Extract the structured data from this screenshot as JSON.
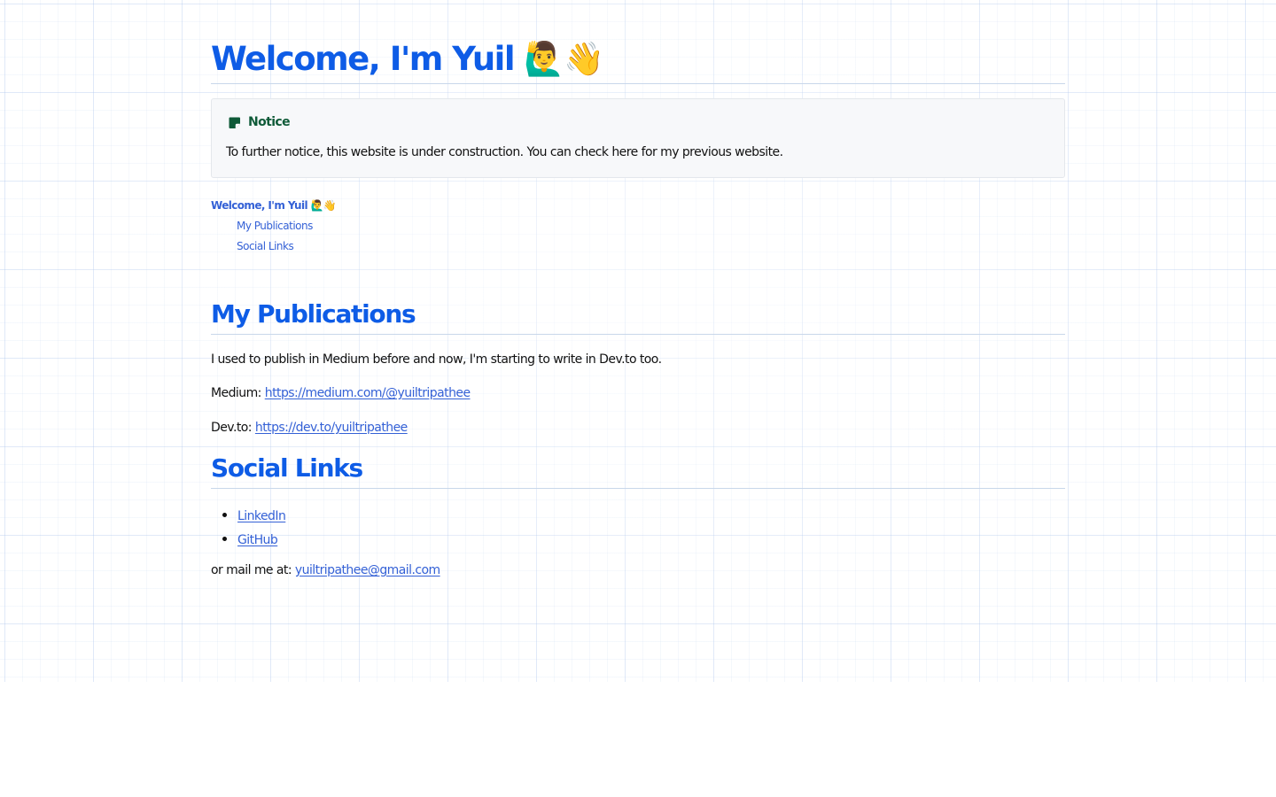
{
  "header": {
    "title": "Welcome, I'm Yuil 🙋‍♂️👋"
  },
  "notice": {
    "title": "Notice",
    "text": "To further notice, this website is under construction. You can check here for my previous website.",
    "accent_color": "#0f5a38"
  },
  "toc": {
    "main": "Welcome, I'm Yuil 🙋‍♂️👋",
    "items": [
      "My Publications",
      "Social Links"
    ]
  },
  "publications": {
    "heading": "My Publications",
    "intro": "I used to publish in Medium before and now, I'm starting to write in Dev.to too.",
    "medium_label": "Medium: ",
    "medium_link": "https://medium.com/@yuiltripathee",
    "devto_label": "Dev.to: ",
    "devto_link": "https://dev.to/yuiltripathee"
  },
  "social": {
    "heading": "Social Links",
    "links": [
      "LinkedIn",
      "GitHub"
    ],
    "mail_label": "or mail me at: ",
    "mail_link": "yuiltripathee@gmail.com"
  },
  "colors": {
    "heading": "#0e5ce6",
    "link": "#3461d6"
  }
}
